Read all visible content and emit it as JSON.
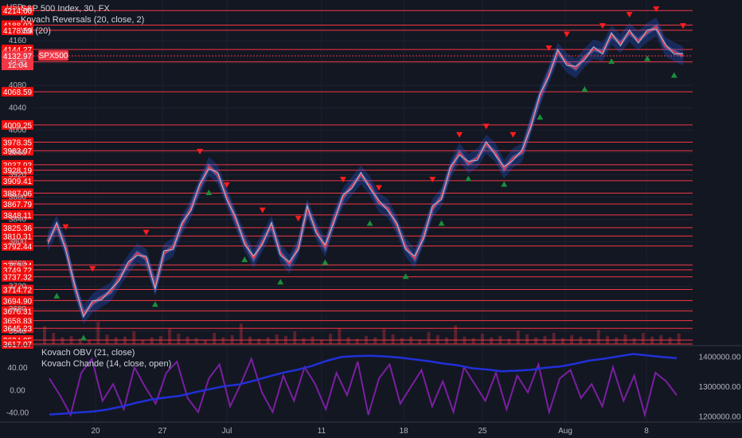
{
  "chart_data": {
    "type": "line",
    "title": "S&P 500 Index, 30, FX",
    "currency": "USD",
    "symbol_badge": "SPX500",
    "current_price": 4132.97,
    "countdown": "12:04",
    "indicators": [
      "Kovach Reversals (20, close, 2)",
      "Vol (20)"
    ],
    "grid": true,
    "price_axis": {
      "ylim": [
        3617,
        4230
      ],
      "ticks": [
        4160,
        4120,
        4080,
        4040,
        4000,
        3960,
        3920,
        3880,
        3840,
        3800,
        3760,
        3720,
        3680,
        3640
      ]
    },
    "levels": [
      4214.0,
      4188.02,
      4178.59,
      4144.27,
      4122.23,
      4068.59,
      4009.25,
      3978.35,
      3963.07,
      3937.93,
      3928.19,
      3909.41,
      3887.06,
      3867.79,
      3848.11,
      3825.36,
      3810.31,
      3792.44,
      3758.34,
      3749.72,
      3737.32,
      3714.72,
      3694.9,
      3676.31,
      3658.83,
      3645.23,
      3624.05,
      3617.07
    ],
    "x_ticks": [
      "20",
      "27",
      "Jul",
      "11",
      "18",
      "25",
      "Aug",
      "8"
    ],
    "price_path": [
      [
        0,
        3800
      ],
      [
        3,
        3830
      ],
      [
        6,
        3790
      ],
      [
        9,
        3720
      ],
      [
        12,
        3670
      ],
      [
        15,
        3690
      ],
      [
        18,
        3700
      ],
      [
        21,
        3710
      ],
      [
        24,
        3735
      ],
      [
        27,
        3760
      ],
      [
        30,
        3780
      ],
      [
        33,
        3770
      ],
      [
        36,
        3720
      ],
      [
        39,
        3780
      ],
      [
        42,
        3790
      ],
      [
        45,
        3830
      ],
      [
        48,
        3860
      ],
      [
        51,
        3900
      ],
      [
        54,
        3935
      ],
      [
        57,
        3920
      ],
      [
        60,
        3880
      ],
      [
        63,
        3840
      ],
      [
        66,
        3800
      ],
      [
        69,
        3770
      ],
      [
        72,
        3800
      ],
      [
        75,
        3830
      ],
      [
        78,
        3780
      ],
      [
        81,
        3760
      ],
      [
        84,
        3790
      ],
      [
        87,
        3860
      ],
      [
        90,
        3820
      ],
      [
        93,
        3790
      ],
      [
        96,
        3840
      ],
      [
        99,
        3880
      ],
      [
        102,
        3900
      ],
      [
        105,
        3920
      ],
      [
        108,
        3900
      ],
      [
        111,
        3870
      ],
      [
        114,
        3860
      ],
      [
        117,
        3830
      ],
      [
        120,
        3790
      ],
      [
        123,
        3770
      ],
      [
        126,
        3810
      ],
      [
        129,
        3860
      ],
      [
        132,
        3880
      ],
      [
        135,
        3930
      ],
      [
        138,
        3960
      ],
      [
        141,
        3940
      ],
      [
        144,
        3950
      ],
      [
        147,
        3975
      ],
      [
        150,
        3960
      ],
      [
        153,
        3930
      ],
      [
        156,
        3950
      ],
      [
        159,
        3960
      ],
      [
        162,
        4010
      ],
      [
        165,
        4060
      ],
      [
        168,
        4100
      ],
      [
        171,
        4140
      ],
      [
        174,
        4120
      ],
      [
        177,
        4110
      ],
      [
        180,
        4130
      ],
      [
        183,
        4145
      ],
      [
        186,
        4140
      ],
      [
        189,
        4170
      ],
      [
        192,
        4155
      ],
      [
        195,
        4175
      ],
      [
        198,
        4160
      ],
      [
        201,
        4175
      ],
      [
        204,
        4185
      ],
      [
        207,
        4150
      ],
      [
        210,
        4140
      ],
      [
        213,
        4132.97
      ]
    ],
    "kovach_reversals": {
      "bearish_markers": [
        [
          6,
          3810
        ],
        [
          15,
          3735
        ],
        [
          33,
          3800
        ],
        [
          51,
          3945
        ],
        [
          60,
          3885
        ],
        [
          72,
          3840
        ],
        [
          84,
          3825
        ],
        [
          99,
          3895
        ],
        [
          111,
          3880
        ],
        [
          129,
          3895
        ],
        [
          138,
          3975
        ],
        [
          147,
          3990
        ],
        [
          156,
          3975
        ],
        [
          168,
          4130
        ],
        [
          174,
          4155
        ],
        [
          186,
          4170
        ],
        [
          195,
          4190
        ],
        [
          204,
          4200
        ],
        [
          213,
          4170
        ]
      ],
      "bullish_markers": [
        [
          3,
          3720
        ],
        [
          12,
          3645
        ],
        [
          36,
          3705
        ],
        [
          54,
          3905
        ],
        [
          66,
          3785
        ],
        [
          78,
          3745
        ],
        [
          93,
          3780
        ],
        [
          108,
          3850
        ],
        [
          120,
          3755
        ],
        [
          132,
          3850
        ],
        [
          141,
          3930
        ],
        [
          153,
          3920
        ],
        [
          165,
          4040
        ],
        [
          180,
          4090
        ],
        [
          189,
          4140
        ],
        [
          201,
          4145
        ],
        [
          210,
          4115
        ]
      ]
    },
    "volume": {
      "values": [
        48,
        30,
        18,
        22,
        15,
        10,
        60,
        25,
        18,
        20,
        34,
        12,
        18,
        22,
        40,
        28,
        20,
        16,
        10,
        30,
        18,
        24,
        55,
        20,
        14,
        18,
        26,
        22,
        34,
        16,
        20,
        12,
        28,
        42,
        18,
        14,
        22,
        18,
        40,
        26,
        16,
        20,
        12,
        32,
        24,
        18,
        50,
        20,
        16,
        28,
        18,
        22,
        14,
        36,
        26,
        18,
        22,
        30,
        16,
        24,
        20,
        14,
        38,
        22,
        18,
        26,
        16,
        30,
        20,
        24,
        18,
        28
      ]
    },
    "lower_pane": {
      "indicators": [
        "Kovach OBV (21, close)",
        "Kovach Chande (14, close, open)"
      ],
      "left_axis": {
        "ticks": [
          "40.00",
          "0.00",
          "-40.00"
        ],
        "ylim": [
          -55,
          70
        ]
      },
      "right_axis": {
        "ticks": [
          "1400000.00",
          "1300000.00",
          "1200000.00"
        ],
        "ylim": [
          1185000,
          1420000
        ]
      },
      "obv": {
        "color": "#2130d8",
        "values": [
          1205000,
          1208000,
          1212000,
          1215000,
          1222000,
          1232000,
          1245000,
          1255000,
          1262000,
          1268000,
          1280000,
          1290000,
          1300000,
          1306000,
          1318000,
          1332000,
          1345000,
          1355000,
          1368000,
          1385000,
          1398000,
          1401000,
          1402000,
          1400000,
          1396000,
          1390000,
          1384000,
          1376000,
          1370000,
          1360000,
          1356000,
          1350000,
          1352000,
          1355000,
          1362000,
          1366000,
          1375000,
          1386000,
          1392000,
          1400000,
          1408000,
          1403000,
          1398000,
          1394000
        ]
      },
      "chande": {
        "color": "#7b1fa2",
        "values": [
          20,
          -10,
          -45,
          30,
          55,
          -20,
          10,
          -35,
          40,
          5,
          -25,
          30,
          50,
          -15,
          -40,
          20,
          45,
          -30,
          10,
          55,
          -5,
          -40,
          25,
          -20,
          40,
          10,
          -35,
          30,
          -10,
          50,
          -45,
          20,
          45,
          -25,
          5,
          35,
          -30,
          15,
          -40,
          40,
          10,
          -20,
          30,
          -35,
          25,
          -5,
          45,
          -40,
          20,
          35,
          -15,
          10,
          -30,
          40,
          -20,
          25,
          -45,
          30,
          15,
          -10
        ]
      }
    }
  }
}
